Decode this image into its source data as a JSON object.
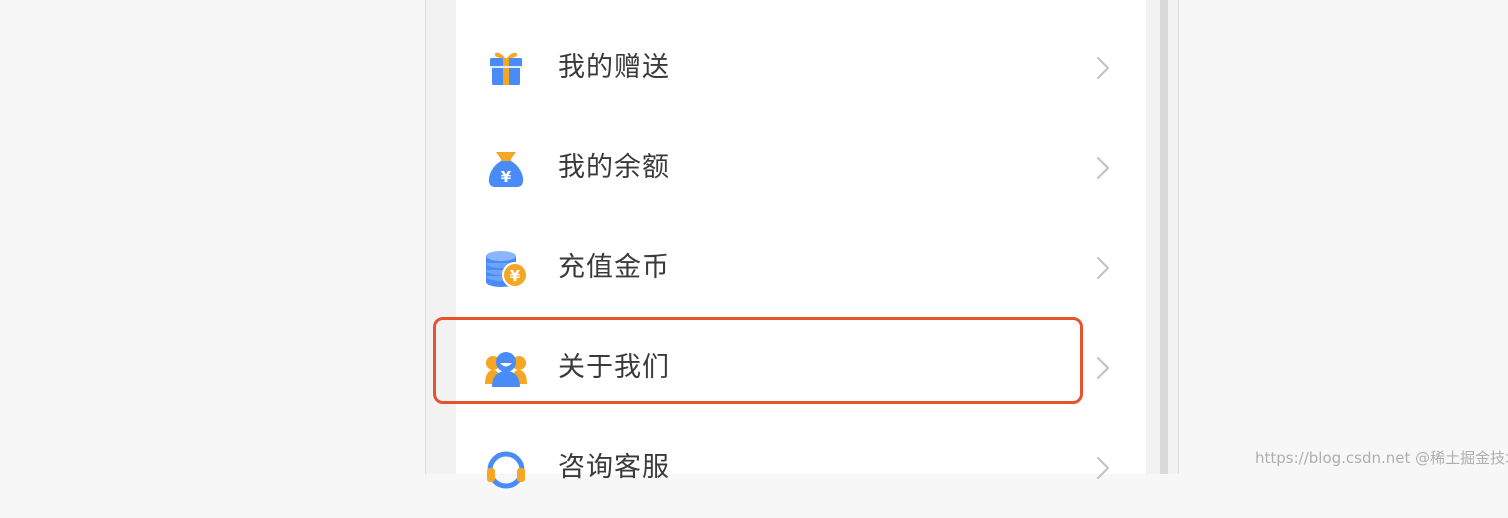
{
  "menu": {
    "items": [
      {
        "label": "我的赠送",
        "icon": "gift-icon"
      },
      {
        "label": "我的余额",
        "icon": "money-bag-icon"
      },
      {
        "label": "充值金币",
        "icon": "coins-icon"
      },
      {
        "label": "关于我们",
        "icon": "about-us-icon"
      },
      {
        "label": "咨询客服",
        "icon": "customer-service-icon"
      }
    ]
  },
  "highlight": {
    "target": "关于我们",
    "color": "#e5532d"
  },
  "colors": {
    "icon_blue": "#4a8cf7",
    "icon_orange": "#f5a623"
  },
  "watermark": "https://blog.csdn.net @稀土掘金技术社区"
}
